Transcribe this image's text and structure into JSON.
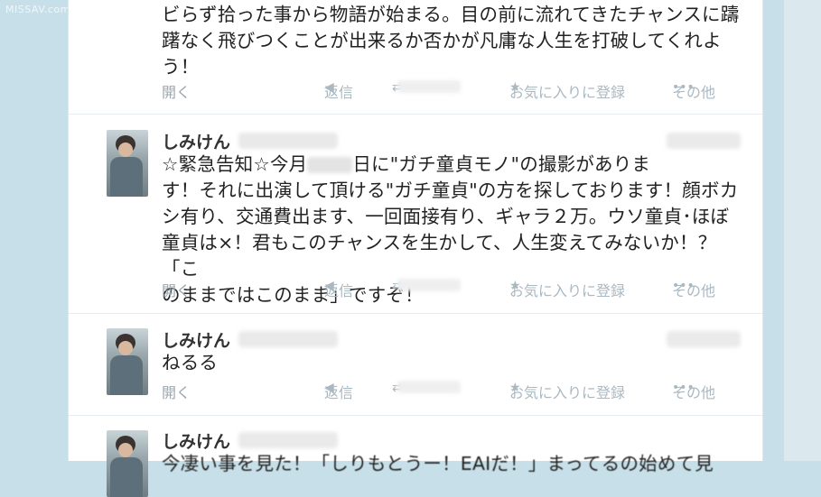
{
  "watermark": "MISSAV.com",
  "actions": {
    "open": "開く",
    "reply": "返信",
    "retweet_glyph": "⇄",
    "favorite": "お気に入りに登録",
    "more": "その他"
  },
  "icons": {
    "reply": "◀",
    "favorite": "★",
    "more": "•••"
  },
  "tweets": [
    {
      "text_lines": [
        "ビらず拾った事から物語が始まる。目の前に流れてきたチャンスに躊",
        "躇なく飛びつくことが出来るか否かが凡庸な人生を打破してくれよ",
        "う！"
      ]
    },
    {
      "name": "しみけん",
      "text_l1_a": "☆緊急告知☆今月",
      "text_l1_b": "日に\"ガチ童貞モノ\"の撮影がありま",
      "text_lines": [
        "す！それに出演して頂ける\"ガチ童貞\"の方を探しております！顔ボカ",
        "シ有り、交通費出ます、一回面接有り、ギャラ２万。ウソ童貞･ほぼ",
        "童貞は×！君もこのチャンスを生かして、人生変えてみないか！？「こ",
        "のままではこのまま」ですぞ！"
      ]
    },
    {
      "name": "しみけん",
      "text_lines": [
        "ねるる"
      ]
    },
    {
      "name": "しみけん",
      "text_lines": [
        "今凄い事を見た！「しりもとうー！EAIだ！」まってるの始めて見"
      ]
    }
  ]
}
